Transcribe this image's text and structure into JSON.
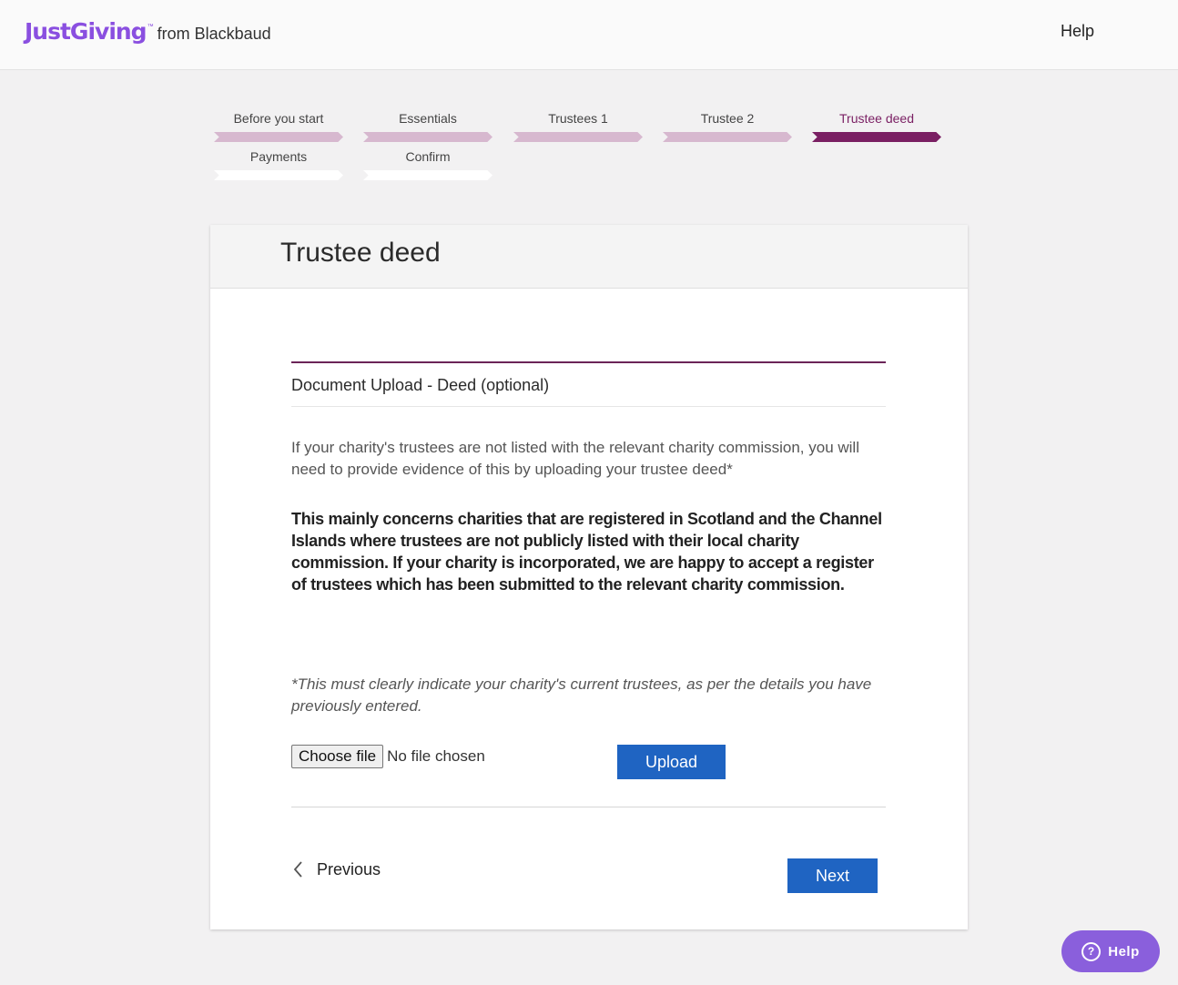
{
  "header": {
    "logo_main": "JustGiving",
    "logo_tm": "™",
    "logo_sub": "from Blackbaud",
    "help_label": "Help"
  },
  "steps": [
    {
      "label": "Before you start",
      "state": "done"
    },
    {
      "label": "Essentials",
      "state": "done"
    },
    {
      "label": "Trustees 1",
      "state": "done"
    },
    {
      "label": "Trustee 2",
      "state": "done"
    },
    {
      "label": "Trustee deed",
      "state": "current"
    },
    {
      "label": "Payments",
      "state": "todo"
    },
    {
      "label": "Confirm",
      "state": "todo"
    }
  ],
  "card": {
    "title": "Trustee deed",
    "section_heading": "Document Upload - Deed (optional)",
    "intro": "If your charity's trustees are not listed with the relevant charity commission, you will need to provide evidence of this by uploading your trustee deed*",
    "bold_text": "This mainly concerns charities that are registered in Scotland and the Channel Islands where trustees are not publicly listed with their local charity commission. If your charity is incorporated, we are happy to accept a register of trustees which has been submitted to the relevant charity commission.",
    "note": "*This must clearly indicate your charity's current trustees, as per the details you have previously entered.",
    "choose_file_label": "Choose file",
    "file_status": "No file chosen",
    "upload_label": "Upload",
    "previous_label": "Previous",
    "next_label": "Next"
  },
  "float_help": {
    "icon": "question-icon",
    "label": "Help"
  },
  "colors": {
    "brand_purple": "#8a4fe0",
    "step_done": "#d7b8cf",
    "step_current": "#7a1f63",
    "primary_button": "#1f64c2"
  }
}
